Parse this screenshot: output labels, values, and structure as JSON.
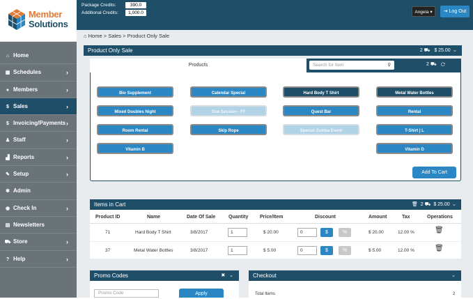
{
  "brand": {
    "line1": "Member",
    "line2": "Solutions"
  },
  "header": {
    "package_credits_label": "Package Credits:",
    "package_credits_value": "390.0",
    "additional_credits_label": "Additional Credits:",
    "additional_credits_value": "1,000.0",
    "user_name": "Angela",
    "logout_label": "Log Out"
  },
  "sidebar": {
    "items": [
      {
        "label": "Home",
        "icon": "home-icon",
        "glyph": "⌂",
        "chev": false
      },
      {
        "label": "Schedules",
        "icon": "calendar-icon",
        "glyph": "▦",
        "chev": true
      },
      {
        "label": "Members",
        "icon": "user-icon",
        "glyph": "●",
        "chev": true
      },
      {
        "label": "Sales",
        "icon": "dollar-icon",
        "glyph": "$",
        "chev": true
      },
      {
        "label": "Invoicing/Payments",
        "icon": "invoice-dollar-icon",
        "glyph": "$",
        "chev": true
      },
      {
        "label": "Staff",
        "icon": "staff-icon",
        "glyph": "♟",
        "chev": true
      },
      {
        "label": "Reports",
        "icon": "chart-icon",
        "glyph": "▟",
        "chev": true
      },
      {
        "label": "Setup",
        "icon": "wrench-icon",
        "glyph": "✎",
        "chev": true
      },
      {
        "label": "Admin",
        "icon": "gear-icon",
        "glyph": "✱",
        "chev": false
      },
      {
        "label": "Check In",
        "icon": "check-in-icon",
        "glyph": "◉",
        "chev": true
      },
      {
        "label": "Newsletters",
        "icon": "newsletter-icon",
        "glyph": "▤",
        "chev": false
      },
      {
        "label": "Store",
        "icon": "cart-icon",
        "glyph": "⛟",
        "chev": true
      },
      {
        "label": "Help",
        "icon": "help-icon",
        "glyph": "?",
        "chev": true
      }
    ]
  },
  "breadcrumb": {
    "home": "Home",
    "sep": ">",
    "sales": "Sales",
    "current": "Product Only Sale"
  },
  "sale_panel": {
    "title": "Product Only Sale",
    "count": "2",
    "total": "$ 25.00"
  },
  "products": {
    "tab_label": "Products",
    "search_placeholder": "Search for Item",
    "cart_count": "2",
    "items": [
      {
        "label": "Bio Supplement",
        "style": "blue"
      },
      {
        "label": "Calendar Special",
        "style": "blue"
      },
      {
        "label": "Hard Body T Shirt",
        "style": "dark"
      },
      {
        "label": "Metal Water Bottles",
        "style": "dark"
      },
      {
        "label": "Mixed Doubles Night",
        "style": "blue"
      },
      {
        "label": "One Session - FF",
        "style": "dis"
      },
      {
        "label": "Quest Bar",
        "style": "blue"
      },
      {
        "label": "Rental",
        "style": "blue"
      },
      {
        "label": "Room Rental",
        "style": "blue"
      },
      {
        "label": "Skip Rope",
        "style": "blue"
      },
      {
        "label": "Special Zumba Event",
        "style": "dis"
      },
      {
        "label": "T-Shirt | L",
        "style": "blue"
      },
      {
        "label": "Vitamin B",
        "style": "blue"
      },
      {
        "label": "Vitamin D",
        "style": "blue"
      }
    ],
    "add_to_cart": "Add To Cart"
  },
  "cart": {
    "title": "Items in Cart",
    "count": "2",
    "total": "$ 25.00",
    "headers": [
      "Product ID",
      "Name",
      "Date Of Sale",
      "Quantity",
      "Price/Item",
      "Discount",
      "Amount",
      "Tax",
      "Operations"
    ],
    "rows": [
      {
        "id": "71",
        "name": "Hard Body T Shirt",
        "date": "3/8/2017",
        "qty": "1",
        "price": "$ 20.00",
        "discount": "0",
        "amount": "$ 20.00",
        "tax": "12.00 %"
      },
      {
        "id": "37",
        "name": "Metal Water Bottles",
        "date": "3/8/2017",
        "qty": "1",
        "price": "$ 5.00",
        "discount": "0",
        "amount": "$ 5.00",
        "tax": "12.00 %"
      }
    ],
    "dollar_btn": "$",
    "percent_btn": "%"
  },
  "promo": {
    "title": "Promo Codes",
    "placeholder": "Promo Code",
    "apply": "Apply"
  },
  "checkout": {
    "title": "Checkout",
    "total_items_label": "Total Items",
    "total_items_value": "2"
  },
  "colors": {
    "navy": "#1f4e69",
    "blue": "#2a87c4",
    "sidebar": "#6a7378",
    "orange": "#e07b39"
  }
}
